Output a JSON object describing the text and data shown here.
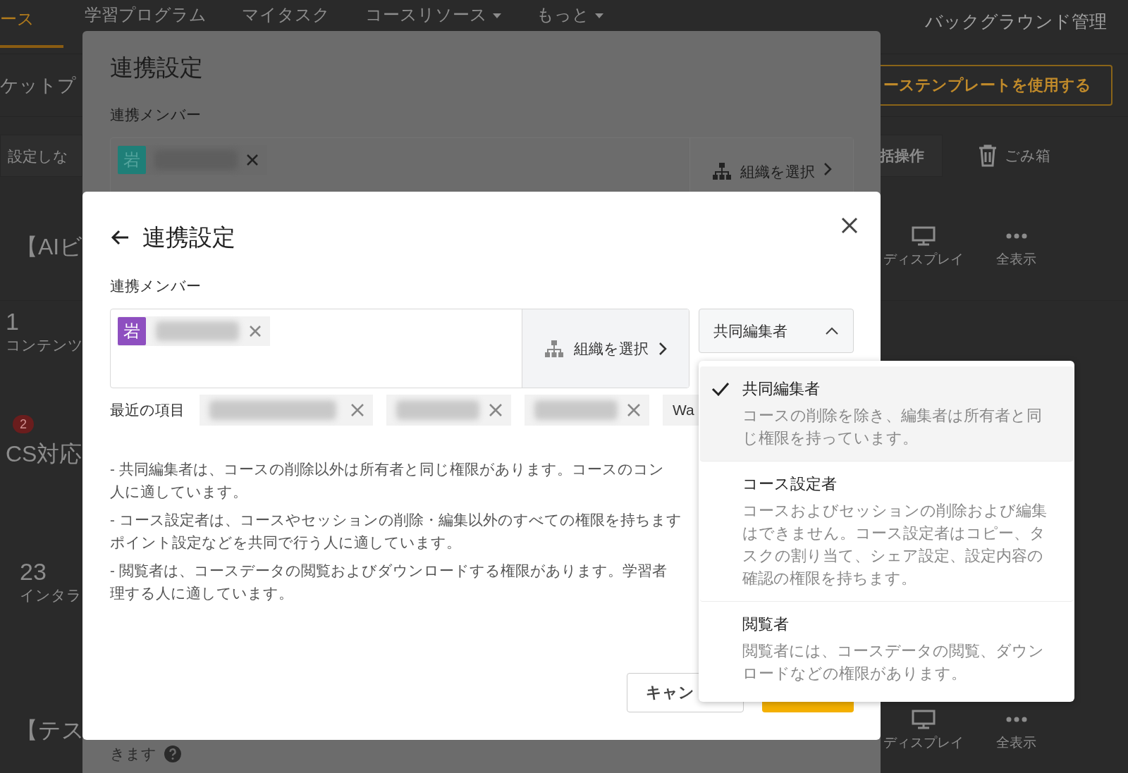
{
  "nav": {
    "items": [
      {
        "label": "ース",
        "selected": true,
        "dropdown": false
      },
      {
        "label": "学習プログラム",
        "selected": false,
        "dropdown": false
      },
      {
        "label": "マイタスク",
        "selected": false,
        "dropdown": false
      },
      {
        "label": "コースリソース",
        "selected": false,
        "dropdown": true
      },
      {
        "label": "もっと",
        "selected": false,
        "dropdown": true
      }
    ],
    "admin": "バックグラウンド管理"
  },
  "header": {
    "title": "ケットプ",
    "template_button": "ーステンプレートを使用する"
  },
  "toolbar": {
    "filter": "設定しな",
    "bulk_button": "括操作",
    "trash": "ごみ箱"
  },
  "courses": [
    {
      "kind": "title",
      "text": "【AIビ",
      "actions": [
        "ディスプレイ",
        "全表示"
      ]
    },
    {
      "kind": "stat",
      "value": "1",
      "label": "コンテンツ"
    },
    {
      "kind": "badge_title",
      "badge": "2",
      "text": "CS対応"
    },
    {
      "kind": "stat",
      "value": "23",
      "label": "インタラ"
    },
    {
      "kind": "title",
      "text": "【テス",
      "actions": [
        "ディスプレイ",
        "全表示"
      ]
    }
  ],
  "back_modal": {
    "title": "連携設定",
    "member_label": "連携メンバー",
    "member": {
      "avatar": "岩",
      "color": "#1f7f78"
    },
    "org_button": "組織を選択",
    "footer_text": "きます"
  },
  "modal": {
    "title": "連携設定",
    "member_label": "連携メンバー",
    "members": [
      {
        "avatar": "岩",
        "color": "#8e4fc0"
      }
    ],
    "org_button": "組織を選択",
    "role_select": {
      "value": "共同編集者",
      "expanded": true
    },
    "recent_label": "最近の項目",
    "recent": [
      {
        "kind": "blurred"
      },
      {
        "kind": "blurred"
      },
      {
        "kind": "blurred"
      },
      {
        "kind": "text",
        "text": "Wa"
      }
    ],
    "notes": [
      [
        "- 共同編集者は、コースの削除以外は所有者と同じ権限があります。コースのコン",
        "人に適しています。"
      ],
      [
        "- コース設定者は、コースやセッションの削除・編集以外のすべての権限を持ちます",
        "ポイント設定などを共同で行う人に適しています。"
      ],
      [
        "- 閲覧者は、コースデータの閲覧およびダウンロードする権限があります。学習者",
        "理する人に適しています。"
      ]
    ],
    "cancel": "キャン",
    "options": [
      {
        "title": "共同編集者",
        "description": "コースの削除を除き、編集者は所有者と同じ権限を持っています。",
        "selected": true
      },
      {
        "title": "コース設定者",
        "description": "コースおよびセッションの削除および編集はできません。コース設定者はコピー、タスクの割り当て、シェア設定、設定内容の確認の権限を持ちます。",
        "selected": false
      },
      {
        "title": "閲覧者",
        "description": "閲覧者には、コースデータの閲覧、ダウンロードなどの権限があります。",
        "selected": false
      }
    ]
  }
}
